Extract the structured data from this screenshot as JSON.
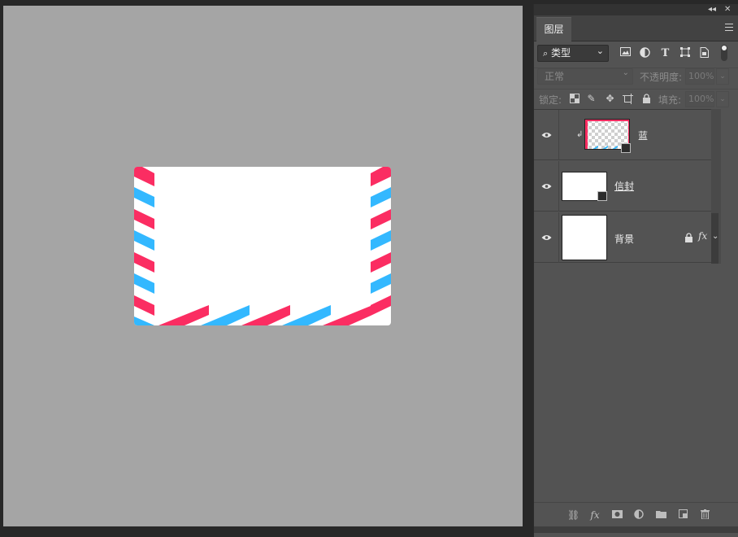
{
  "panel": {
    "collapse_glyph": "◂◂",
    "close_glyph": "✕",
    "tab_label": "图层",
    "filter": {
      "label": "类型",
      "search_glyph": "⌕",
      "chevron_glyph": "⌄"
    },
    "filter_icons": [
      "image-filter-icon",
      "adjustment-filter-icon",
      "type-filter-icon",
      "shape-filter-icon",
      "smart-object-filter-icon"
    ],
    "blend": {
      "mode": "正常",
      "opacity_label": "不透明度:",
      "opacity_value": "100%"
    },
    "lock": {
      "label": "锁定:",
      "fill_label": "填充:",
      "fill_value": "100%"
    },
    "layers": [
      {
        "name": "蓝",
        "visible": true,
        "clipped": true,
        "transparent_thumb": true,
        "smart_object": true
      },
      {
        "name": "信封",
        "visible": true,
        "clipped": false,
        "transparent_thumb": false,
        "shape_layer": true
      },
      {
        "name": "背景",
        "visible": true,
        "locked": true,
        "has_fx": true,
        "fx_label": "fx"
      }
    ],
    "bottom_icons": [
      "link-layers-icon",
      "fx-icon",
      "add-mask-icon",
      "adjustment-layer-icon",
      "new-group-icon",
      "new-layer-icon",
      "delete-layer-icon"
    ]
  },
  "canvas": {
    "background_color": "#a5a5a5",
    "envelope_color": "#ffffff",
    "stripe_colors": [
      "#fb2d62",
      "#33b8ff"
    ]
  }
}
